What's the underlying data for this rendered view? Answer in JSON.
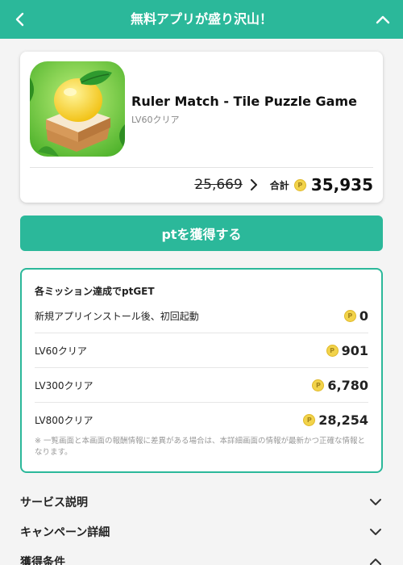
{
  "header": {
    "title": "無料アプリが盛り沢山！"
  },
  "app": {
    "name": "Ruler Match - Tile Puzzle Game",
    "subtitle": "LV60クリア",
    "old_price": "25,669",
    "total_label": "合計",
    "total_value": "35,935",
    "coin_symbol": "P"
  },
  "get_button_label": "ptを獲得する",
  "missions": {
    "title": "各ミッション達成でptGET",
    "rows": [
      {
        "label": "新規アプリインストール後、初回起動",
        "reward": "0"
      },
      {
        "label": "LV60クリア",
        "reward": "901"
      },
      {
        "label": "LV300クリア",
        "reward": "6,780"
      },
      {
        "label": "LV800クリア",
        "reward": "28,254"
      }
    ],
    "note": "※ 一覧画面と本画面の報酬情報に差異がある場合は、本詳細画面の情報が最新かつ正確な情報となります。"
  },
  "accordions": [
    {
      "label": "サービス説明",
      "state": "collapsed"
    },
    {
      "label": "キャンペーン詳細",
      "state": "collapsed"
    },
    {
      "label": "獲得条件",
      "state": "expanded"
    }
  ],
  "colors": {
    "accent": "#2bb89a",
    "coin": "#f2d34a"
  },
  "icons": {
    "back": "chevron-left-icon",
    "collapse": "chevron-up-icon",
    "arrow": "chevron-right-icon",
    "coin": "coin-icon",
    "expand": "chevron-down-icon"
  }
}
